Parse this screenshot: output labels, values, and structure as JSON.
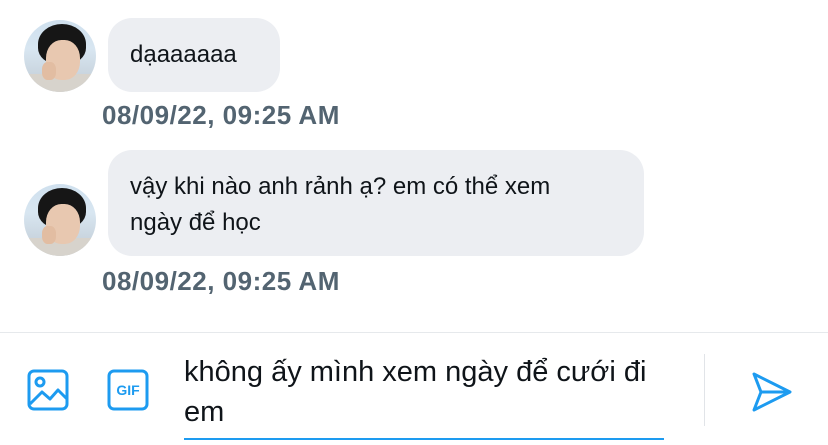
{
  "messages": [
    {
      "text": "dạaaaaaa",
      "timestamp": "08/09/22, 09:25 AM"
    },
    {
      "text": "vậy khi nào anh rảnh ạ? em có thể xem ngày để học",
      "timestamp": "08/09/22, 09:25 AM"
    }
  ],
  "composer": {
    "input_value": "không ấy mình xem ngày để cưới đi em",
    "gif_label": "GIF"
  },
  "icons": {
    "image": "image-icon",
    "gif": "gif-icon",
    "send": "send-icon"
  },
  "colors": {
    "accent": "#1d9bf0",
    "bubble": "#eceef2",
    "timestamp": "#536471"
  }
}
